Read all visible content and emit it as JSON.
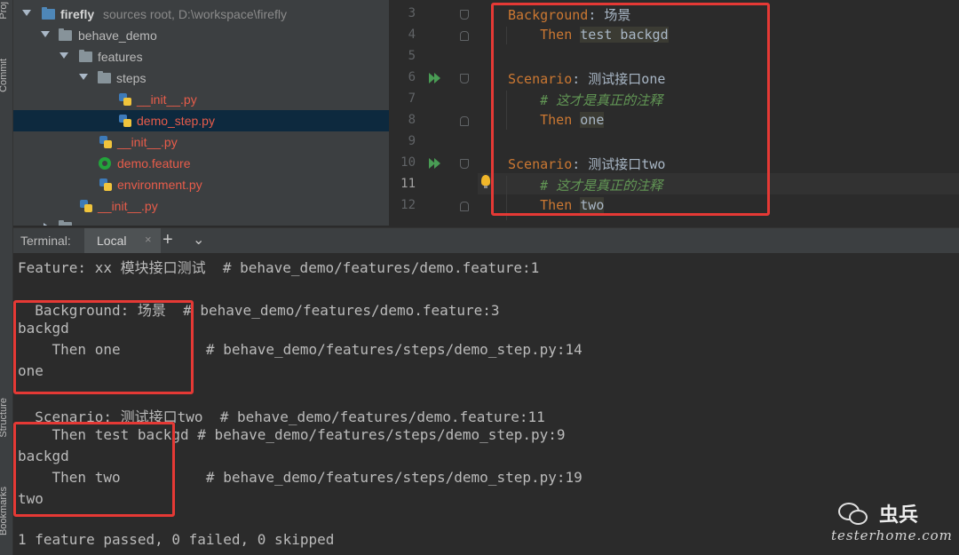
{
  "side_tabs": {
    "project": "Proj",
    "commit": "Commit",
    "structure": "Structure",
    "bookmarks": "Bookmarks"
  },
  "project_tree": {
    "root_name": "firefly",
    "root_hint": "sources root,  D:\\workspace\\firefly",
    "items": [
      {
        "label": "behave_demo"
      },
      {
        "label": "features"
      },
      {
        "label": "steps"
      },
      {
        "label": "__init__.py"
      },
      {
        "label": "demo_step.py"
      },
      {
        "label": "__init__.py"
      },
      {
        "label": "demo.feature"
      },
      {
        "label": "environment.py"
      },
      {
        "label": "__init__.py"
      }
    ]
  },
  "editor": {
    "line_numbers": [
      "3",
      "4",
      "5",
      "6",
      "7",
      "8",
      "9",
      "10",
      "11",
      "12"
    ],
    "current_line": "11",
    "lines": {
      "l3_kw": "Background",
      "l3_rest": ": 场景",
      "l4_kw": "Then",
      "l4_hl": "test backgd",
      "l6_kw": "Scenario",
      "l6_rest": ": 测试接口one",
      "l7_cmt": "# 这才是真正的注释",
      "l8_kw": "Then",
      "l8_hl": "one",
      "l10_kw": "Scenario",
      "l10_rest": ": 测试接口two",
      "l11_cmt": "# 这才是真正的注释",
      "l12_kw": "Then",
      "l12_hl": "two"
    }
  },
  "terminal": {
    "title": "Terminal:",
    "tab_label": "Local",
    "tab_close": "×",
    "new_tab": "+",
    "dropdown": "⌄",
    "lines": [
      "Feature: xx 模块接口测试  # behave_demo/features/demo.feature:1",
      "",
      "  Background: 场景  # behave_demo/features/demo.feature:3",
      "backgd",
      "    Then one          # behave_demo/features/steps/demo_step.py:14",
      "one",
      "",
      "  Scenario: 测试接口two  # behave_demo/features/demo.feature:11",
      "    Then test backgd # behave_demo/features/steps/demo_step.py:9",
      "backgd",
      "    Then two          # behave_demo/features/steps/demo_step.py:19",
      "two",
      "",
      "1 feature passed, 0 failed, 0 skipped"
    ]
  },
  "watermark": {
    "name": "虫兵",
    "site": "testerhome.com"
  }
}
